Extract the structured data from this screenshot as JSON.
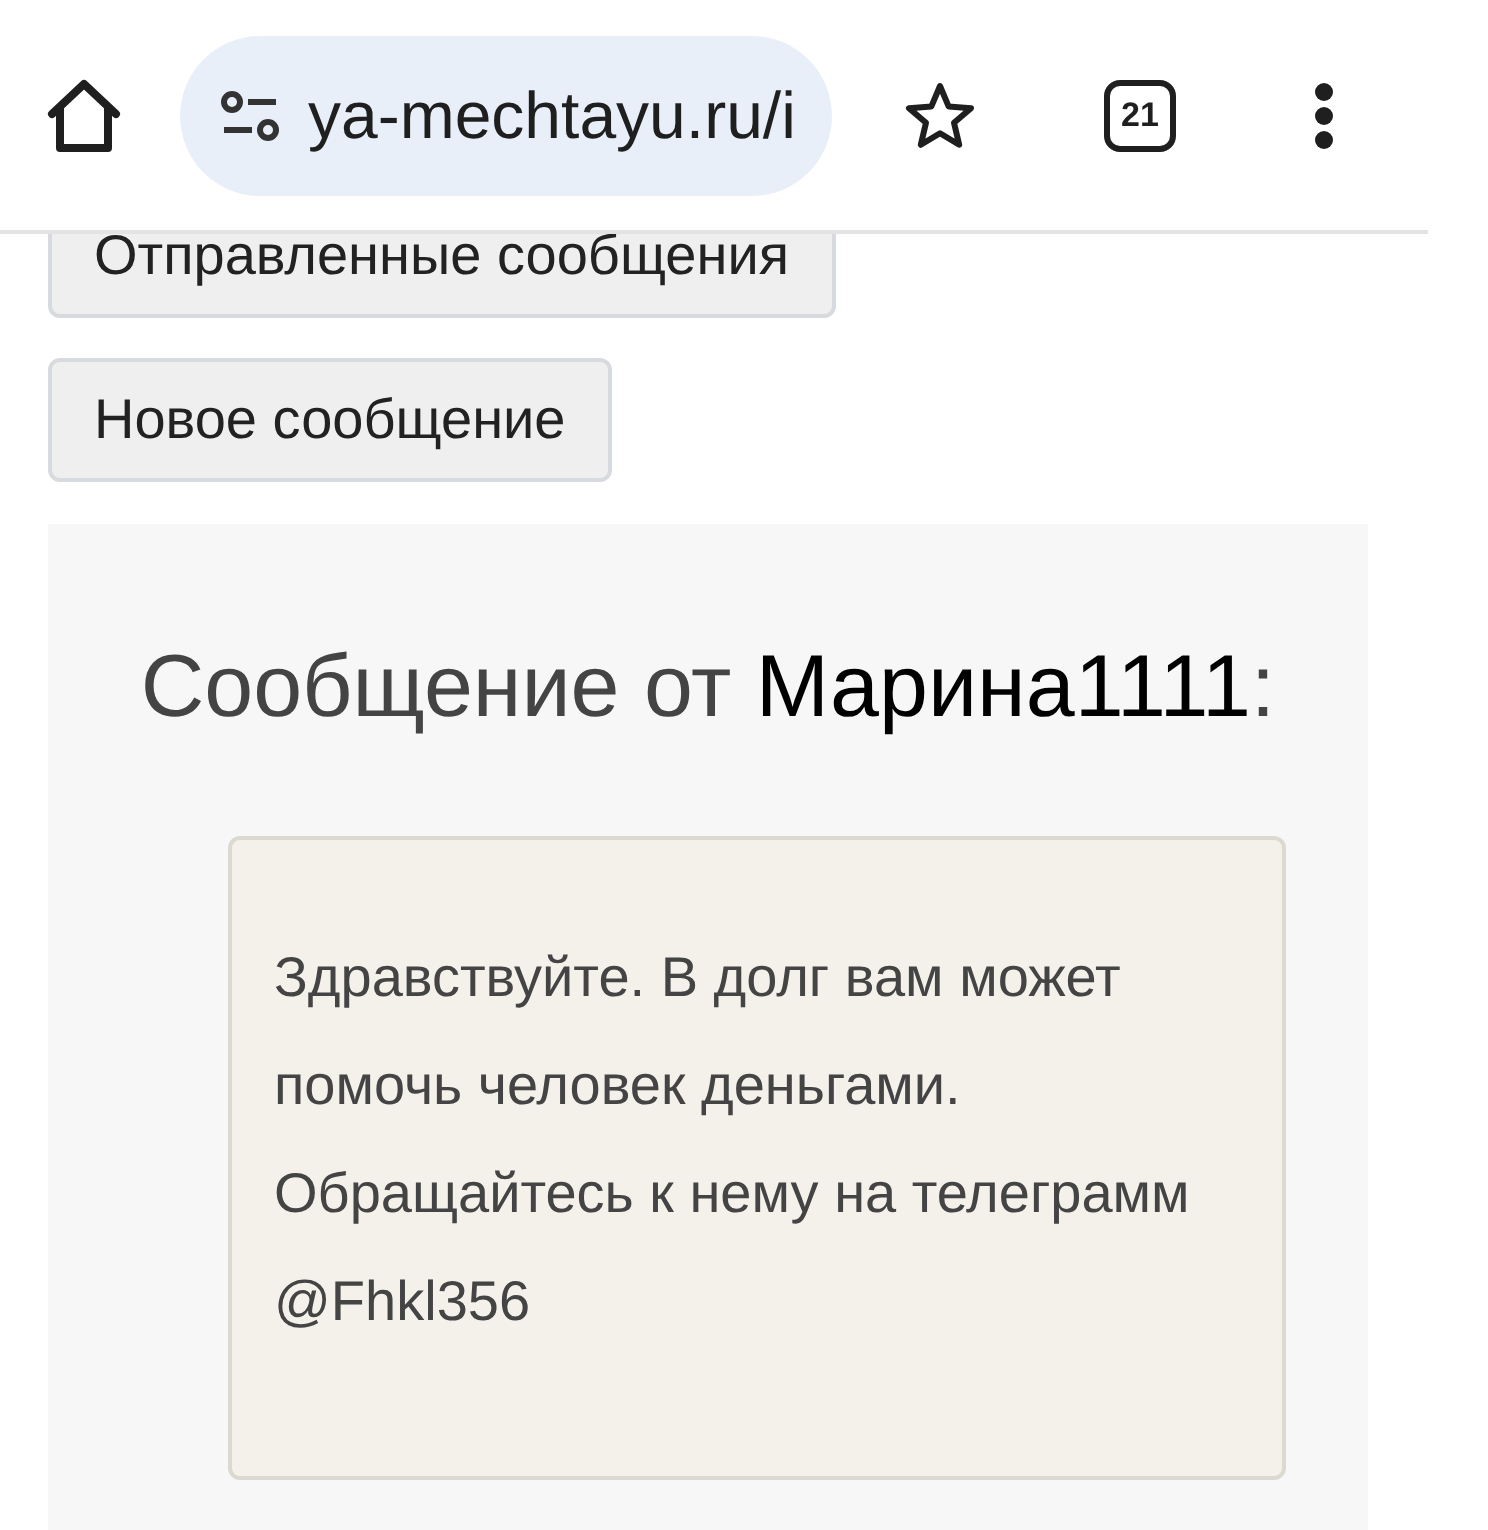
{
  "browser": {
    "url": "ya-mechtayu.ru/i",
    "tab_count": "21"
  },
  "nav_buttons": [
    "Отправленные сообщения",
    "Новое сообщение"
  ],
  "message": {
    "heading": "Сообщение от **Марина1111**:",
    "body": "Здравствуйте. В долг вам может помочь человек деньгами. Обращайтесь к нему на телеграмм @Fhkl356"
  }
}
